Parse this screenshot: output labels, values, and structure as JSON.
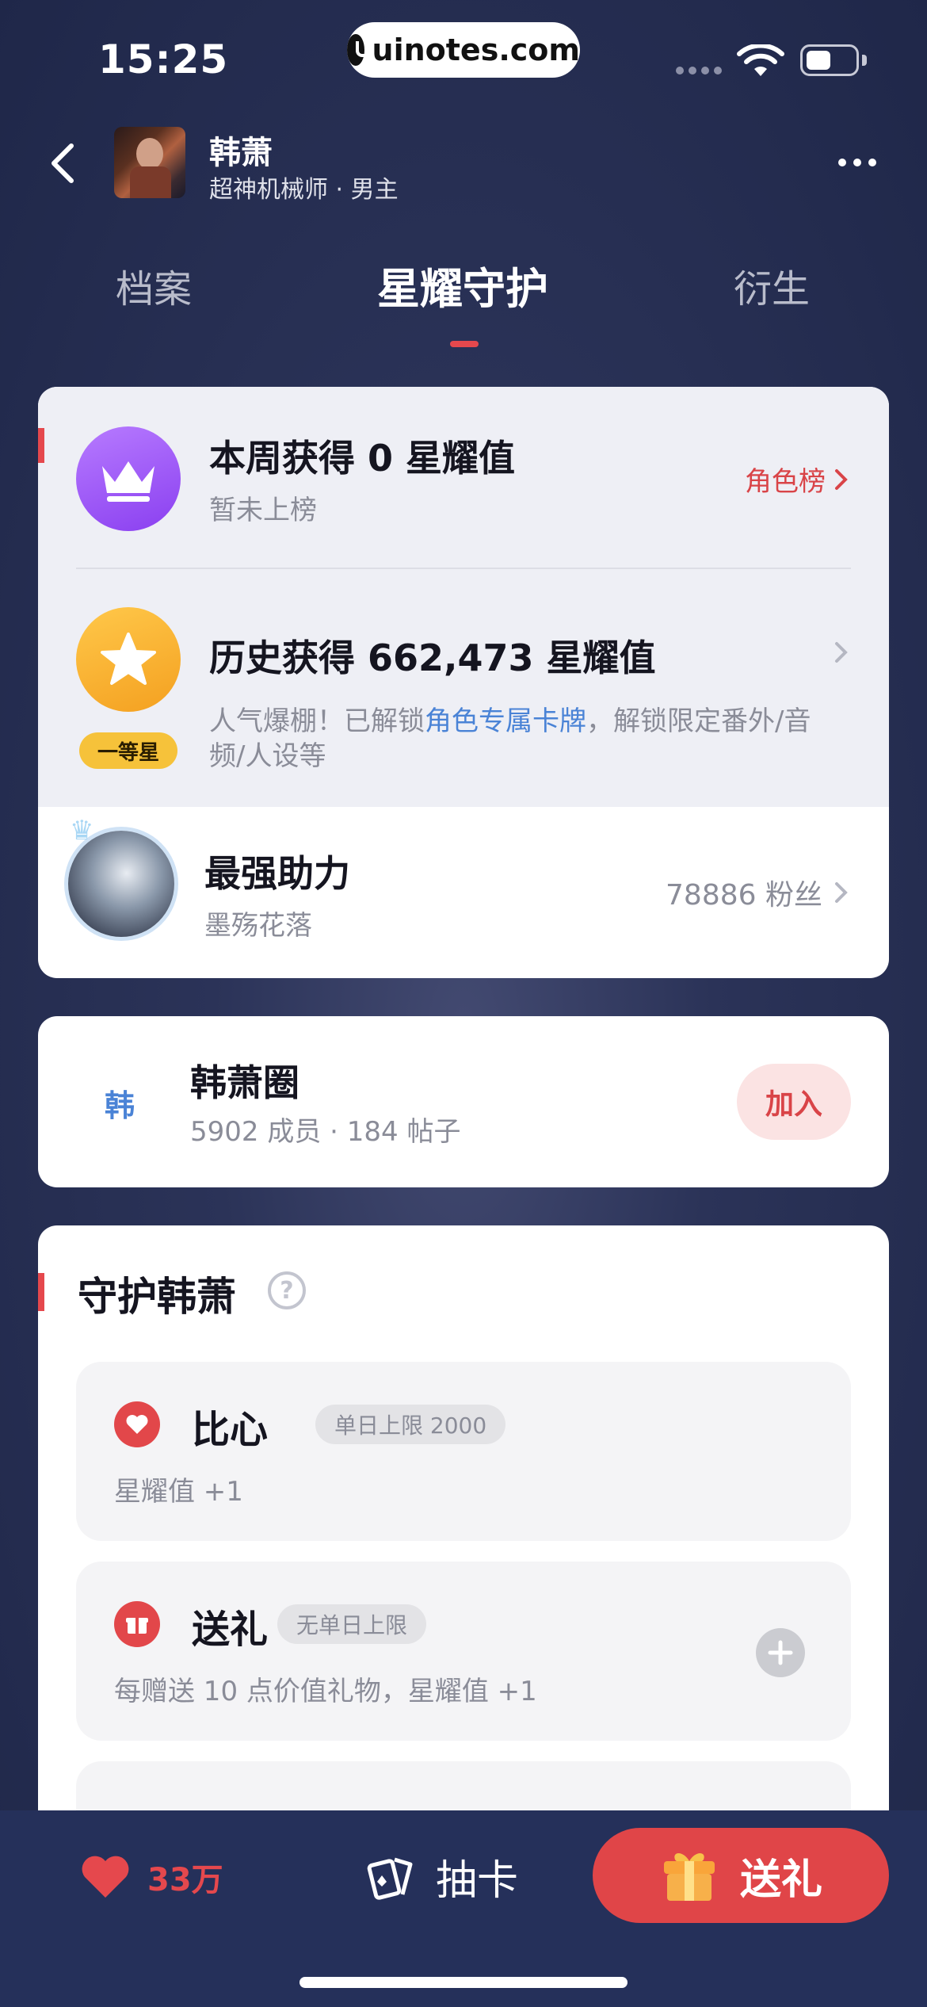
{
  "status": {
    "time": "15:25",
    "url": "uinotes.com"
  },
  "header": {
    "name": "韩萧",
    "subtitle": "超神机械师 · 男主"
  },
  "tabs": [
    "档案",
    "星耀守护",
    "衍生"
  ],
  "weekly": {
    "title": "本周获得 0 星耀值",
    "sub": "暂未上榜",
    "link": "角色榜"
  },
  "history": {
    "title": "历史获得 662,473 星耀值",
    "badge": "一等星",
    "desc_before": "人气爆棚！已解锁",
    "desc_highlight": "角色专属卡牌",
    "desc_after": "，解锁限定番外/音频/人设等"
  },
  "helper": {
    "title": "最强助力",
    "name": "墨殇花落",
    "fans": "78886 粉丝"
  },
  "circle": {
    "initial": "韩",
    "name": "韩萧圈",
    "stats": "5902 成员 · 184 帖子",
    "join": "加入"
  },
  "guard": {
    "title": "守护韩萧",
    "tasks": [
      {
        "name": "比心",
        "limit": "单日上限 2000",
        "desc": "星耀值 +1"
      },
      {
        "name": "送礼",
        "limit": "无单日上限",
        "desc": "每赠送 10 点价值礼物，星耀值 +1"
      }
    ]
  },
  "bottom": {
    "likes": "33万",
    "draw": "抽卡",
    "gift": "送礼"
  },
  "colors": {
    "accent": "#e5484d",
    "link_blue": "#4a83d6",
    "bg": "#2b3358"
  }
}
